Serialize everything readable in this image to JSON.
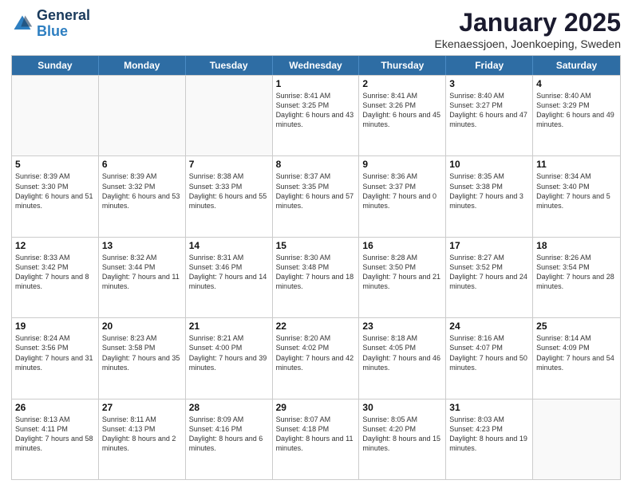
{
  "logo": {
    "general": "General",
    "blue": "Blue"
  },
  "title": "January 2025",
  "subtitle": "Ekenaessjoen, Joenkoeping, Sweden",
  "headers": [
    "Sunday",
    "Monday",
    "Tuesday",
    "Wednesday",
    "Thursday",
    "Friday",
    "Saturday"
  ],
  "rows": [
    [
      {
        "day": "",
        "info": ""
      },
      {
        "day": "",
        "info": ""
      },
      {
        "day": "",
        "info": ""
      },
      {
        "day": "1",
        "info": "Sunrise: 8:41 AM\nSunset: 3:25 PM\nDaylight: 6 hours and 43 minutes."
      },
      {
        "day": "2",
        "info": "Sunrise: 8:41 AM\nSunset: 3:26 PM\nDaylight: 6 hours and 45 minutes."
      },
      {
        "day": "3",
        "info": "Sunrise: 8:40 AM\nSunset: 3:27 PM\nDaylight: 6 hours and 47 minutes."
      },
      {
        "day": "4",
        "info": "Sunrise: 8:40 AM\nSunset: 3:29 PM\nDaylight: 6 hours and 49 minutes."
      }
    ],
    [
      {
        "day": "5",
        "info": "Sunrise: 8:39 AM\nSunset: 3:30 PM\nDaylight: 6 hours and 51 minutes."
      },
      {
        "day": "6",
        "info": "Sunrise: 8:39 AM\nSunset: 3:32 PM\nDaylight: 6 hours and 53 minutes."
      },
      {
        "day": "7",
        "info": "Sunrise: 8:38 AM\nSunset: 3:33 PM\nDaylight: 6 hours and 55 minutes."
      },
      {
        "day": "8",
        "info": "Sunrise: 8:37 AM\nSunset: 3:35 PM\nDaylight: 6 hours and 57 minutes."
      },
      {
        "day": "9",
        "info": "Sunrise: 8:36 AM\nSunset: 3:37 PM\nDaylight: 7 hours and 0 minutes."
      },
      {
        "day": "10",
        "info": "Sunrise: 8:35 AM\nSunset: 3:38 PM\nDaylight: 7 hours and 3 minutes."
      },
      {
        "day": "11",
        "info": "Sunrise: 8:34 AM\nSunset: 3:40 PM\nDaylight: 7 hours and 5 minutes."
      }
    ],
    [
      {
        "day": "12",
        "info": "Sunrise: 8:33 AM\nSunset: 3:42 PM\nDaylight: 7 hours and 8 minutes."
      },
      {
        "day": "13",
        "info": "Sunrise: 8:32 AM\nSunset: 3:44 PM\nDaylight: 7 hours and 11 minutes."
      },
      {
        "day": "14",
        "info": "Sunrise: 8:31 AM\nSunset: 3:46 PM\nDaylight: 7 hours and 14 minutes."
      },
      {
        "day": "15",
        "info": "Sunrise: 8:30 AM\nSunset: 3:48 PM\nDaylight: 7 hours and 18 minutes."
      },
      {
        "day": "16",
        "info": "Sunrise: 8:28 AM\nSunset: 3:50 PM\nDaylight: 7 hours and 21 minutes."
      },
      {
        "day": "17",
        "info": "Sunrise: 8:27 AM\nSunset: 3:52 PM\nDaylight: 7 hours and 24 minutes."
      },
      {
        "day": "18",
        "info": "Sunrise: 8:26 AM\nSunset: 3:54 PM\nDaylight: 7 hours and 28 minutes."
      }
    ],
    [
      {
        "day": "19",
        "info": "Sunrise: 8:24 AM\nSunset: 3:56 PM\nDaylight: 7 hours and 31 minutes."
      },
      {
        "day": "20",
        "info": "Sunrise: 8:23 AM\nSunset: 3:58 PM\nDaylight: 7 hours and 35 minutes."
      },
      {
        "day": "21",
        "info": "Sunrise: 8:21 AM\nSunset: 4:00 PM\nDaylight: 7 hours and 39 minutes."
      },
      {
        "day": "22",
        "info": "Sunrise: 8:20 AM\nSunset: 4:02 PM\nDaylight: 7 hours and 42 minutes."
      },
      {
        "day": "23",
        "info": "Sunrise: 8:18 AM\nSunset: 4:05 PM\nDaylight: 7 hours and 46 minutes."
      },
      {
        "day": "24",
        "info": "Sunrise: 8:16 AM\nSunset: 4:07 PM\nDaylight: 7 hours and 50 minutes."
      },
      {
        "day": "25",
        "info": "Sunrise: 8:14 AM\nSunset: 4:09 PM\nDaylight: 7 hours and 54 minutes."
      }
    ],
    [
      {
        "day": "26",
        "info": "Sunrise: 8:13 AM\nSunset: 4:11 PM\nDaylight: 7 hours and 58 minutes."
      },
      {
        "day": "27",
        "info": "Sunrise: 8:11 AM\nSunset: 4:13 PM\nDaylight: 8 hours and 2 minutes."
      },
      {
        "day": "28",
        "info": "Sunrise: 8:09 AM\nSunset: 4:16 PM\nDaylight: 8 hours and 6 minutes."
      },
      {
        "day": "29",
        "info": "Sunrise: 8:07 AM\nSunset: 4:18 PM\nDaylight: 8 hours and 11 minutes."
      },
      {
        "day": "30",
        "info": "Sunrise: 8:05 AM\nSunset: 4:20 PM\nDaylight: 8 hours and 15 minutes."
      },
      {
        "day": "31",
        "info": "Sunrise: 8:03 AM\nSunset: 4:23 PM\nDaylight: 8 hours and 19 minutes."
      },
      {
        "day": "",
        "info": ""
      }
    ]
  ]
}
